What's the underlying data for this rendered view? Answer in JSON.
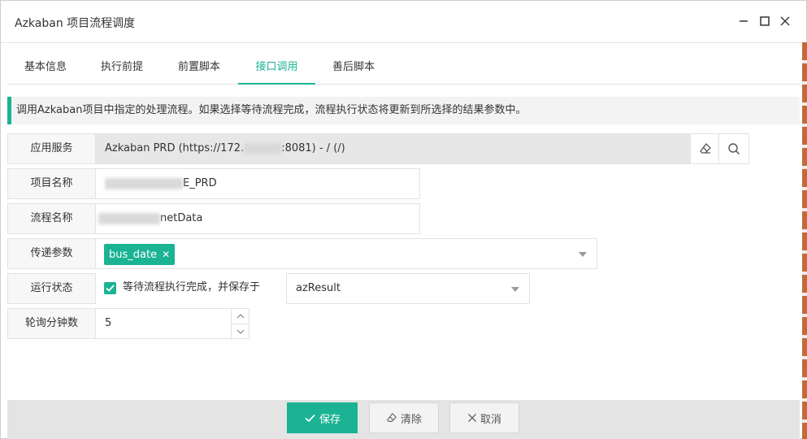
{
  "window": {
    "title": "Azkaban 项目流程调度"
  },
  "tabs": [
    {
      "label": "基本信息"
    },
    {
      "label": "执行前提"
    },
    {
      "label": "前置脚本"
    },
    {
      "label": "接口调用"
    },
    {
      "label": "善后脚本"
    }
  ],
  "active_tab": "接口调用",
  "tip": "调用Azkaban项目中指定的处理流程。如果选择等待流程完成，流程执行状态将更新到所选择的结果参数中。",
  "form": {
    "service": {
      "label": "应用服务",
      "value_prefix": "Azkaban PRD (https://172.",
      "value_suffix": ":8081) - / (/)"
    },
    "project": {
      "label": "项目名称",
      "value_suffix": "E_PRD"
    },
    "flow": {
      "label": "流程名称",
      "value_suffix": "netData"
    },
    "params": {
      "label": "传递参数",
      "tags": [
        "bus_date"
      ]
    },
    "status": {
      "label": "运行状态",
      "checkbox_label": "等待流程执行完成，并保存于",
      "checked": true,
      "result_param": "azResult"
    },
    "poll": {
      "label": "轮询分钟数",
      "value": "5"
    }
  },
  "footer": {
    "save": "保存",
    "clear": "清除",
    "cancel": "取消"
  },
  "colors": {
    "accent": "#1bb394"
  }
}
